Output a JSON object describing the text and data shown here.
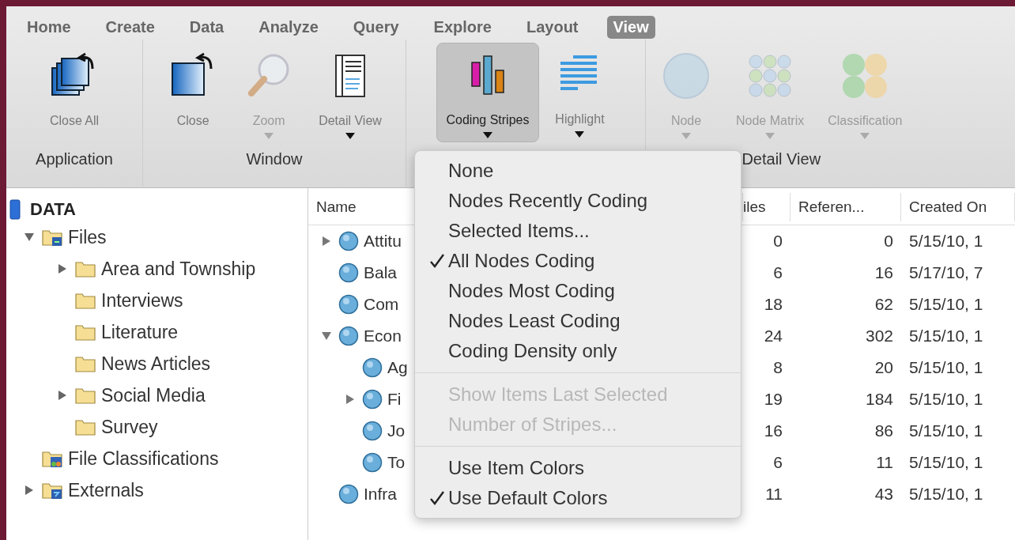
{
  "ribbon_tabs": [
    {
      "label": "Home",
      "selected": false
    },
    {
      "label": "Create",
      "selected": false
    },
    {
      "label": "Data",
      "selected": false
    },
    {
      "label": "Analyze",
      "selected": false
    },
    {
      "label": "Query",
      "selected": false
    },
    {
      "label": "Explore",
      "selected": false
    },
    {
      "label": "Layout",
      "selected": false
    },
    {
      "label": "View",
      "selected": true
    }
  ],
  "ribbon_groups": [
    {
      "label": "Application",
      "buttons": [
        {
          "label": "Close All",
          "disabled": false,
          "dropdown": false,
          "selected": false
        }
      ]
    },
    {
      "label": "Window",
      "buttons": [
        {
          "label": "Close",
          "disabled": false,
          "dropdown": false,
          "selected": false
        },
        {
          "label": "Zoom",
          "disabled": true,
          "dropdown": true,
          "selected": false
        },
        {
          "label": "Detail View",
          "disabled": false,
          "dropdown": true,
          "selected": false
        }
      ]
    },
    {
      "buttons": [
        {
          "label": "Coding Stripes",
          "disabled": false,
          "dropdown": true,
          "selected": true
        },
        {
          "label": "Highlight",
          "disabled": false,
          "dropdown": true,
          "selected": false
        }
      ]
    },
    {
      "label": "Detail View",
      "buttons": [
        {
          "label": "Node",
          "disabled": true,
          "dropdown": true,
          "selected": false
        },
        {
          "label": "Node Matrix",
          "disabled": true,
          "dropdown": true,
          "selected": false
        },
        {
          "label": "Classification",
          "disabled": true,
          "dropdown": true,
          "selected": false
        }
      ]
    }
  ],
  "sidebar": {
    "title": "DATA",
    "items": [
      {
        "label": "Files",
        "kind": "files",
        "has_children": true,
        "expanded": true,
        "children": [
          {
            "label": "Area and Township",
            "kind": "folder",
            "has_children": true,
            "expanded": false
          },
          {
            "label": "Interviews",
            "kind": "folder",
            "has_children": false
          },
          {
            "label": "Literature",
            "kind": "folder",
            "has_children": false
          },
          {
            "label": "News Articles",
            "kind": "folder",
            "has_children": false
          },
          {
            "label": "Social Media",
            "kind": "folder",
            "has_children": true,
            "expanded": false
          },
          {
            "label": "Survey",
            "kind": "folder",
            "has_children": false
          }
        ]
      },
      {
        "label": "File Classifications",
        "kind": "classifications",
        "has_children": false
      },
      {
        "label": "Externals",
        "kind": "externals",
        "has_children": true,
        "expanded": false
      }
    ]
  },
  "table": {
    "columns": [
      "Name",
      "iles",
      "Referen...",
      "Created On"
    ],
    "rows": [
      {
        "name": "Attitu",
        "files": "0",
        "references": "0",
        "created_on": "5/15/10, 1",
        "has_children": true,
        "expanded": false
      },
      {
        "name": "Bala",
        "files": "6",
        "references": "16",
        "created_on": "5/17/10, 7",
        "has_children": false
      },
      {
        "name": "Com",
        "files": "18",
        "references": "62",
        "created_on": "5/15/10, 1",
        "has_children": false
      },
      {
        "name": "Econ",
        "files": "24",
        "references": "302",
        "created_on": "5/15/10, 1",
        "has_children": true,
        "expanded": true,
        "children": [
          {
            "name": "Ag",
            "files": "8",
            "references": "20",
            "created_on": "5/15/10, 1",
            "has_children": false
          },
          {
            "name": "Fi",
            "files": "19",
            "references": "184",
            "created_on": "5/15/10, 1",
            "has_children": true,
            "expanded": false
          },
          {
            "name": "Jo",
            "files": "16",
            "references": "86",
            "created_on": "5/15/10, 1",
            "has_children": false
          },
          {
            "name": "To",
            "files": "6",
            "references": "11",
            "created_on": "5/15/10, 1",
            "has_children": false
          }
        ]
      },
      {
        "name": "Infra",
        "files": "11",
        "references": "43",
        "created_on": "5/15/10, 1",
        "has_children": false
      }
    ]
  },
  "dropdown_menu": {
    "sections": [
      [
        {
          "label": "None",
          "checked": false,
          "disabled": false
        },
        {
          "label": "Nodes Recently Coding",
          "checked": false,
          "disabled": false
        },
        {
          "label": "Selected Items...",
          "checked": false,
          "disabled": false
        },
        {
          "label": "All Nodes Coding",
          "checked": true,
          "disabled": false
        },
        {
          "label": "Nodes Most Coding",
          "checked": false,
          "disabled": false
        },
        {
          "label": "Nodes Least Coding",
          "checked": false,
          "disabled": false
        },
        {
          "label": "Coding Density only",
          "checked": false,
          "disabled": false
        }
      ],
      [
        {
          "label": "Show Items Last Selected",
          "checked": false,
          "disabled": true
        },
        {
          "label": "Number of Stripes...",
          "checked": false,
          "disabled": true
        }
      ],
      [
        {
          "label": "Use Item Colors",
          "checked": false,
          "disabled": false
        },
        {
          "label": "Use Default Colors",
          "checked": true,
          "disabled": false
        }
      ]
    ]
  }
}
